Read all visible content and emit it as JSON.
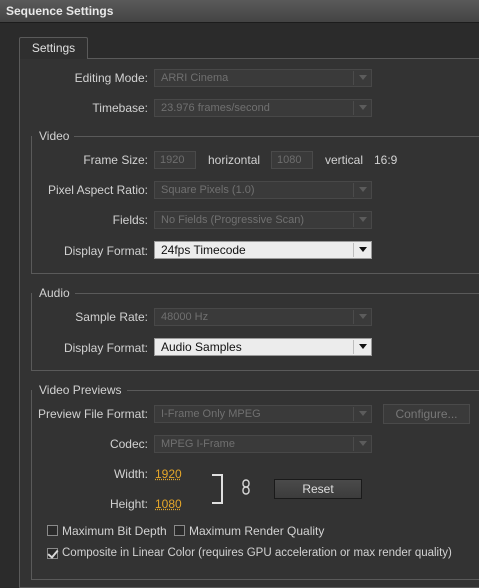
{
  "window": {
    "title": "Sequence Settings"
  },
  "tabs": [
    {
      "label": "Settings"
    }
  ],
  "general": {
    "editing_mode": {
      "label": "Editing Mode:",
      "value": "ARRI Cinema"
    },
    "timebase": {
      "label": "Timebase:",
      "value": "23.976 frames/second"
    }
  },
  "video": {
    "title": "Video",
    "frame_size": {
      "label": "Frame Size:",
      "width": "1920",
      "horizontal_label": "horizontal",
      "height": "1080",
      "vertical_label": "vertical",
      "aspect": "16:9"
    },
    "pixel_aspect_ratio": {
      "label": "Pixel Aspect Ratio:",
      "value": "Square Pixels (1.0)"
    },
    "fields": {
      "label": "Fields:",
      "value": "No Fields (Progressive Scan)"
    },
    "display_format": {
      "label": "Display Format:",
      "value": "24fps Timecode"
    }
  },
  "audio": {
    "title": "Audio",
    "sample_rate": {
      "label": "Sample Rate:",
      "value": "48000 Hz"
    },
    "display_format": {
      "label": "Display Format:",
      "value": "Audio Samples"
    }
  },
  "video_previews": {
    "title": "Video Previews",
    "preview_file_format": {
      "label": "Preview File Format:",
      "value": "I-Frame Only MPEG"
    },
    "configure_label": "Configure...",
    "codec": {
      "label": "Codec:",
      "value": "MPEG I-Frame"
    },
    "width": {
      "label": "Width:",
      "value": "1920"
    },
    "height": {
      "label": "Height:",
      "value": "1080"
    },
    "reset_label": "Reset",
    "max_bit_depth": {
      "label": "Maximum Bit Depth",
      "checked": false
    },
    "max_render_quality": {
      "label": "Maximum Render Quality",
      "checked": false
    },
    "composite_linear": {
      "label": "Composite in Linear Color (requires GPU acceleration or max render quality)",
      "checked": true
    }
  }
}
